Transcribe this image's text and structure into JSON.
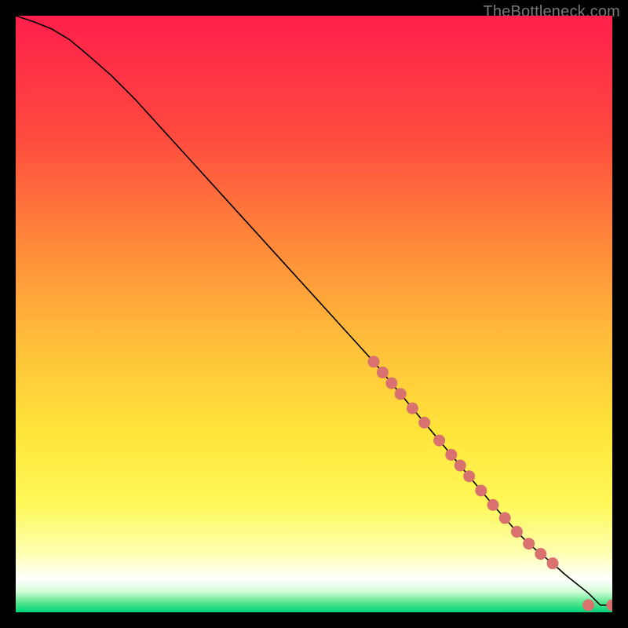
{
  "watermark": "TheBottleneck.com",
  "chart_data": {
    "type": "line",
    "title": "",
    "xlabel": "",
    "ylabel": "",
    "xlim": [
      0,
      100
    ],
    "ylim": [
      0,
      100
    ],
    "grid": false,
    "background_gradient": {
      "direction": "vertical",
      "stops": [
        {
          "pos": 0.0,
          "color": "#ff1f4b"
        },
        {
          "pos": 0.2,
          "color": "#ff4a3f"
        },
        {
          "pos": 0.4,
          "color": "#ff8f3a"
        },
        {
          "pos": 0.55,
          "color": "#ffbf3a"
        },
        {
          "pos": 0.7,
          "color": "#ffe53a"
        },
        {
          "pos": 0.82,
          "color": "#fff95a"
        },
        {
          "pos": 0.9,
          "color": "#fdffb0"
        },
        {
          "pos": 0.945,
          "color": "#ffffff"
        },
        {
          "pos": 0.965,
          "color": "#d4ffd8"
        },
        {
          "pos": 0.985,
          "color": "#4fe58a"
        },
        {
          "pos": 1.0,
          "color": "#00d27a"
        }
      ]
    },
    "series": [
      {
        "name": "bottleneck-curve",
        "color": "#000000",
        "width": 1.6,
        "x": [
          0,
          3,
          6,
          9,
          12,
          16,
          20,
          25,
          30,
          35,
          40,
          45,
          50,
          55,
          60,
          65,
          70,
          75,
          80,
          84,
          86,
          88,
          90,
          91,
          92,
          93,
          94,
          95,
          96,
          98,
          100
        ],
        "y": [
          100,
          99,
          97.8,
          96,
          93.5,
          90,
          86,
          80.5,
          75,
          69.5,
          64,
          58.5,
          53,
          47.5,
          42,
          36,
          30,
          24,
          18,
          13.5,
          11.5,
          9.8,
          8.2,
          7.3,
          6.4,
          5.6,
          4.8,
          4,
          3.2,
          1.2,
          1.2
        ]
      }
    ],
    "marker_series": {
      "name": "highlight-points",
      "color": "#d9716e",
      "radius": 7.5,
      "points": [
        {
          "x": 60.0,
          "y": 42.0
        },
        {
          "x": 61.5,
          "y": 40.2
        },
        {
          "x": 63.0,
          "y": 38.4
        },
        {
          "x": 64.5,
          "y": 36.6
        },
        {
          "x": 66.5,
          "y": 34.2
        },
        {
          "x": 68.5,
          "y": 31.8
        },
        {
          "x": 71.0,
          "y": 28.8
        },
        {
          "x": 73.0,
          "y": 26.4
        },
        {
          "x": 74.5,
          "y": 24.6
        },
        {
          "x": 76.0,
          "y": 22.8
        },
        {
          "x": 78.0,
          "y": 20.4
        },
        {
          "x": 80.0,
          "y": 18.0
        },
        {
          "x": 82.0,
          "y": 15.8
        },
        {
          "x": 84.0,
          "y": 13.5
        },
        {
          "x": 86.0,
          "y": 11.5
        },
        {
          "x": 88.0,
          "y": 9.8
        },
        {
          "x": 90.0,
          "y": 8.2
        },
        {
          "x": 96.0,
          "y": 1.2
        },
        {
          "x": 100.0,
          "y": 1.2
        }
      ]
    }
  }
}
